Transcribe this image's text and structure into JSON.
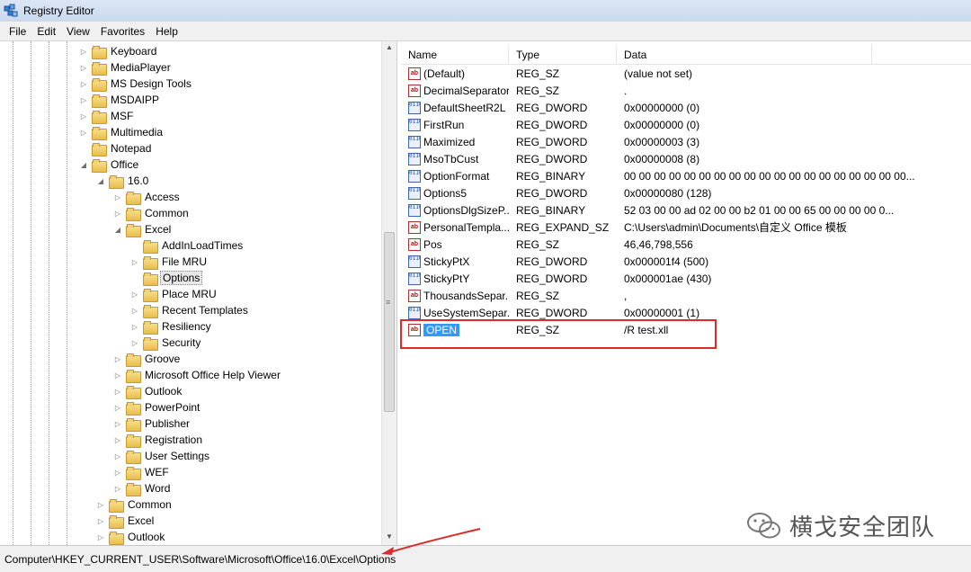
{
  "window": {
    "title": "Registry Editor"
  },
  "menu": [
    "File",
    "Edit",
    "View",
    "Favorites",
    "Help"
  ],
  "tree": [
    {
      "label": "Keyboard",
      "level": 0,
      "exp": "collapsed"
    },
    {
      "label": "MediaPlayer",
      "level": 0,
      "exp": "collapsed"
    },
    {
      "label": "MS Design Tools",
      "level": 0,
      "exp": "collapsed"
    },
    {
      "label": "MSDAIPP",
      "level": 0,
      "exp": "collapsed"
    },
    {
      "label": "MSF",
      "level": 0,
      "exp": "collapsed"
    },
    {
      "label": "Multimedia",
      "level": 0,
      "exp": "collapsed"
    },
    {
      "label": "Notepad",
      "level": 0,
      "exp": "none"
    },
    {
      "label": "Office",
      "level": 0,
      "exp": "expanded"
    },
    {
      "label": "16.0",
      "level": 1,
      "exp": "expanded"
    },
    {
      "label": "Access",
      "level": 2,
      "exp": "collapsed"
    },
    {
      "label": "Common",
      "level": 2,
      "exp": "collapsed"
    },
    {
      "label": "Excel",
      "level": 2,
      "exp": "expanded"
    },
    {
      "label": "AddInLoadTimes",
      "level": 3,
      "exp": "none"
    },
    {
      "label": "File MRU",
      "level": 3,
      "exp": "collapsed"
    },
    {
      "label": "Options",
      "level": 3,
      "exp": "none",
      "selected": true
    },
    {
      "label": "Place MRU",
      "level": 3,
      "exp": "collapsed"
    },
    {
      "label": "Recent Templates",
      "level": 3,
      "exp": "collapsed"
    },
    {
      "label": "Resiliency",
      "level": 3,
      "exp": "collapsed"
    },
    {
      "label": "Security",
      "level": 3,
      "exp": "collapsed"
    },
    {
      "label": "Groove",
      "level": 2,
      "exp": "collapsed"
    },
    {
      "label": "Microsoft Office Help Viewer",
      "level": 2,
      "exp": "collapsed"
    },
    {
      "label": "Outlook",
      "level": 2,
      "exp": "collapsed"
    },
    {
      "label": "PowerPoint",
      "level": 2,
      "exp": "collapsed"
    },
    {
      "label": "Publisher",
      "level": 2,
      "exp": "collapsed"
    },
    {
      "label": "Registration",
      "level": 2,
      "exp": "collapsed"
    },
    {
      "label": "User Settings",
      "level": 2,
      "exp": "collapsed"
    },
    {
      "label": "WEF",
      "level": 2,
      "exp": "collapsed"
    },
    {
      "label": "Word",
      "level": 2,
      "exp": "collapsed"
    },
    {
      "label": "Common",
      "level": 1,
      "exp": "collapsed"
    },
    {
      "label": "Excel",
      "level": 1,
      "exp": "collapsed"
    },
    {
      "label": "Outlook",
      "level": 1,
      "exp": "collapsed"
    }
  ],
  "columns": {
    "name": "Name",
    "type": "Type",
    "data": "Data"
  },
  "values": [
    {
      "name": "(Default)",
      "type": "REG_SZ",
      "data": "(value not set)",
      "icon": "string-value-icon"
    },
    {
      "name": "DecimalSeparator",
      "type": "REG_SZ",
      "data": ".",
      "icon": "string-value-icon"
    },
    {
      "name": "DefaultSheetR2L",
      "type": "REG_DWORD",
      "data": "0x00000000 (0)",
      "icon": "binary-value-icon"
    },
    {
      "name": "FirstRun",
      "type": "REG_DWORD",
      "data": "0x00000000 (0)",
      "icon": "binary-value-icon"
    },
    {
      "name": "Maximized",
      "type": "REG_DWORD",
      "data": "0x00000003 (3)",
      "icon": "binary-value-icon"
    },
    {
      "name": "MsoTbCust",
      "type": "REG_DWORD",
      "data": "0x00000008 (8)",
      "icon": "binary-value-icon"
    },
    {
      "name": "OptionFormat",
      "type": "REG_BINARY",
      "data": "00 00 00 00 00 00 00 00 00 00 00 00 00 00 00 00 00 00 00...",
      "icon": "binary-value-icon"
    },
    {
      "name": "Options5",
      "type": "REG_DWORD",
      "data": "0x00000080 (128)",
      "icon": "binary-value-icon"
    },
    {
      "name": "OptionsDlgSizeP...",
      "type": "REG_BINARY",
      "data": "52 03 00 00 ad 02 00 00 b2 01 00 00 65 00 00 00 00 0...",
      "icon": "binary-value-icon"
    },
    {
      "name": "PersonalTempla...",
      "type": "REG_EXPAND_SZ",
      "data": "C:\\Users\\admin\\Documents\\自定义 Office 模板",
      "icon": "string-value-icon"
    },
    {
      "name": "Pos",
      "type": "REG_SZ",
      "data": "46,46,798,556",
      "icon": "string-value-icon"
    },
    {
      "name": "StickyPtX",
      "type": "REG_DWORD",
      "data": "0x000001f4 (500)",
      "icon": "binary-value-icon"
    },
    {
      "name": "StickyPtY",
      "type": "REG_DWORD",
      "data": "0x000001ae (430)",
      "icon": "binary-value-icon"
    },
    {
      "name": "ThousandsSepar...",
      "type": "REG_SZ",
      "data": ",",
      "icon": "string-value-icon"
    },
    {
      "name": "UseSystemSepar...",
      "type": "REG_DWORD",
      "data": "0x00000001 (1)",
      "icon": "binary-value-icon"
    },
    {
      "name": "OPEN",
      "type": "REG_SZ",
      "data": "/R test.xll",
      "icon": "string-value-icon",
      "selected": true
    }
  ],
  "status": {
    "path": "Computer\\HKEY_CURRENT_USER\\Software\\Microsoft\\Office\\16.0\\Excel\\Options"
  },
  "watermark": {
    "text": "横戈安全团队"
  },
  "colors": {
    "highlight_box": "#e02a2a",
    "selection": "#3399ff",
    "arrow": "#e02a2a"
  }
}
